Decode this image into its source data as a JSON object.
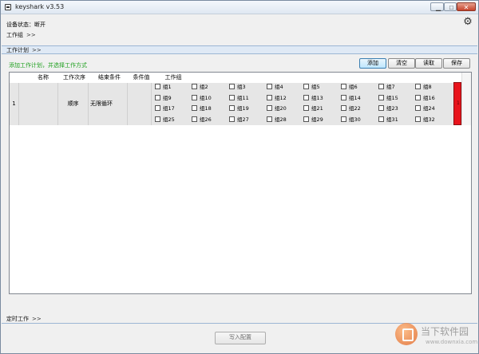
{
  "window": {
    "title": "keyshark v3.53",
    "minimize_label": "▁",
    "maximize_label": "□",
    "close_label": "✕"
  },
  "status": {
    "text": "设备状态：断开"
  },
  "sections": {
    "group": "工作组",
    "plan": "工作计划",
    "timer": "定时工作",
    "chevron": ">>"
  },
  "toolbar": {
    "hint": "添加工作计划，并选择工作方式",
    "add": "添加",
    "clear": "清空",
    "read": "读取",
    "save": "保存"
  },
  "table": {
    "columns": [
      "名称",
      "工作次序",
      "结束条件",
      "条件值",
      "工作组"
    ],
    "row": {
      "index": "1",
      "name": "",
      "order": "顺序",
      "end_condition": "无限循环",
      "condition_value": "",
      "groups": [
        "组1",
        "组2",
        "组3",
        "组4",
        "组5",
        "组6",
        "组7",
        "组8",
        "组9",
        "组10",
        "组11",
        "组12",
        "组13",
        "组14",
        "组15",
        "组16",
        "组17",
        "组18",
        "组19",
        "组20",
        "组21",
        "组22",
        "组23",
        "组24",
        "组25",
        "组26",
        "组27",
        "组28",
        "组29",
        "组30",
        "组31",
        "组32"
      ],
      "selector_mark": "1"
    }
  },
  "footer": {
    "write_config": "写入配置"
  },
  "watermark": {
    "name": "当下软件园",
    "url": "www.downxia.com"
  },
  "colors": {
    "hint": "#20a020",
    "selector": "#e8141c",
    "section_bar": "#dfe9f5"
  }
}
